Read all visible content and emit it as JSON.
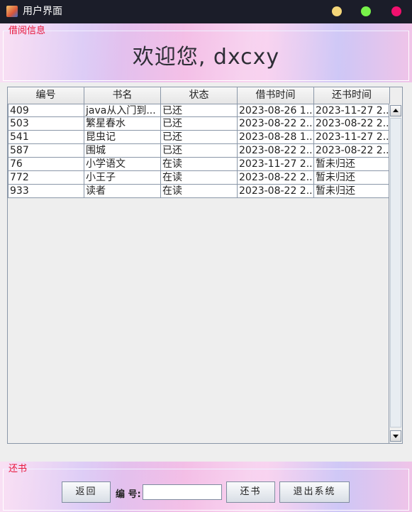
{
  "window": {
    "title": "用户界面",
    "controls": [
      "yellow",
      "green",
      "pink"
    ]
  },
  "borrow_panel": {
    "title": "借阅信息",
    "welcome": "欢迎您, dxcxy"
  },
  "table": {
    "columns": [
      "编号",
      "书名",
      "状态",
      "借书时间",
      "还书时间"
    ],
    "rows": [
      [
        "409",
        "java从入门到...",
        "已还",
        "2023-08-26 1...",
        "2023-11-27 2..."
      ],
      [
        "503",
        "繁星春水",
        "已还",
        "2023-08-22 2...",
        "2023-08-22 2..."
      ],
      [
        "541",
        "昆虫记",
        "已还",
        "2023-08-28 1...",
        "2023-11-27 2..."
      ],
      [
        "587",
        "围城",
        "已还",
        "2023-08-22 2...",
        "2023-08-22 2..."
      ],
      [
        "76",
        "小学语文",
        "在读",
        "2023-11-27 2...",
        "暂未归还"
      ],
      [
        "772",
        "小王子",
        "在读",
        "2023-08-22 2...",
        "暂未归还"
      ],
      [
        "933",
        "读者",
        "在读",
        "2023-08-22 2...",
        "暂未归还"
      ]
    ]
  },
  "return_panel": {
    "title": "还书",
    "back_label": "返回",
    "id_label": "编 号:",
    "id_value": "",
    "return_label": "还书",
    "exit_label": "退出系统"
  },
  "colors": {
    "titlebar": "#1b1d29",
    "group_title": "#e8143a",
    "dot_yellow": "#f4d679",
    "dot_green": "#78f24a",
    "dot_pink": "#f2106e"
  }
}
